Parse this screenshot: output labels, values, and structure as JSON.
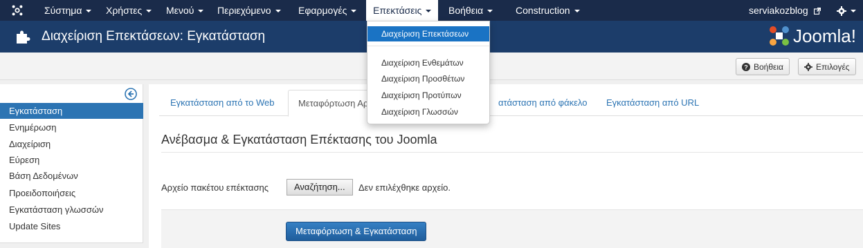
{
  "nav": {
    "items": [
      {
        "label": "Σύστημα"
      },
      {
        "label": "Χρήστες"
      },
      {
        "label": "Μενού"
      },
      {
        "label": "Περιεχόμενο"
      },
      {
        "label": "Εφαρμογές"
      },
      {
        "label": "Επεκτάσεις"
      },
      {
        "label": "Βοήθεια"
      },
      {
        "label": "Construction"
      }
    ],
    "user": "serviakozblog"
  },
  "header": {
    "title": "Διαχείριση Επεκτάσεων: Εγκατάσταση",
    "brand": "Joomla!"
  },
  "toolbar": {
    "help_label": "Βοήθεια",
    "options_label": "Επιλογές"
  },
  "sidebar": {
    "items": [
      {
        "label": "Εγκατάσταση"
      },
      {
        "label": "Ενημέρωση"
      },
      {
        "label": "Διαχείριση"
      },
      {
        "label": "Εύρεση"
      },
      {
        "label": "Βάση Δεδομένων"
      },
      {
        "label": "Προειδοποιήσεις"
      },
      {
        "label": "Εγκατάσταση γλωσσών"
      },
      {
        "label": "Update Sites"
      }
    ]
  },
  "tabs": [
    {
      "label": "Εγκατάσταση από το Web"
    },
    {
      "label": "Μεταφόρτωση Αρ"
    },
    {
      "label": "ατάσταση από φάκελο"
    },
    {
      "label": "Εγκατάσταση από URL"
    }
  ],
  "main": {
    "section_title": "Ανέβασμα & Εγκατάσταση Επέκτασης του Joomla",
    "field_label": "Αρχείο πακέτου επέκτασης",
    "browse_label": "Αναζήτηση...",
    "no_file": "Δεν επιλέχθηκε αρχείο.",
    "upload_label": "Μεταφόρτωση & Εγκατάσταση"
  },
  "dropdown": {
    "items": [
      {
        "label": "Διαχείριση Επεκτάσεων"
      },
      {
        "label": "Διαχείριση Ενθεμάτων"
      },
      {
        "label": "Διαχείριση Προσθέτων"
      },
      {
        "label": "Διαχείριση Προτύπων"
      },
      {
        "label": "Διαχείριση Γλωσσών"
      }
    ]
  },
  "colors": {
    "navbar": "#1a2b4a",
    "titlebar": "#1c3d6a",
    "accent": "#2c74b3",
    "highlight": "#1a73c4"
  }
}
